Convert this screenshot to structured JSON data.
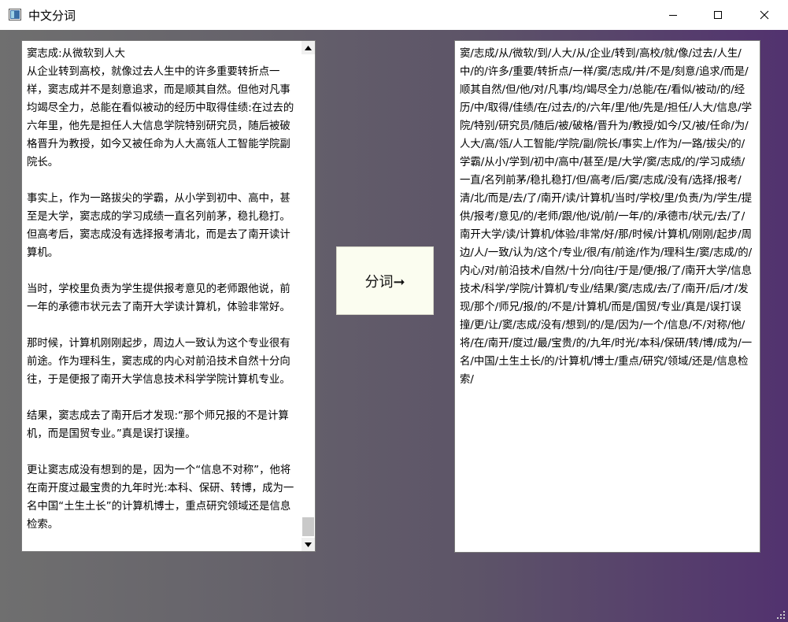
{
  "window": {
    "title": "中文分词",
    "controls": {
      "minimize_icon": "minimize-icon",
      "maximize_icon": "maximize-icon",
      "close_icon": "close-icon"
    },
    "colors": {
      "background_start": "#6f6f6f",
      "background_end": "#52326f",
      "button_bg": "#fbfdf0"
    }
  },
  "input": {
    "text": "窦志成:从微软到人大\n从企业转到高校，就像过去人生中的许多重要转折点一样，窦志成并不是刻意追求，而是顺其自然。但他对凡事均竭尽全力，总能在看似被动的经历中取得佳绩:在过去的六年里，他先是担任人大信息学院特别研究员，随后被破格晋升为教授，如今又被任命为人大高瓴人工智能学院副院长。\n\n事实上，作为一路拔尖的学霸，从小学到初中、高中，甚至是大学，窦志成的学习成绩一直名列前茅，稳扎稳打。但高考后，窦志成没有选择报考清北，而是去了南开读计算机。\n\n当时，学校里负责为学生提供报考意见的老师跟他说，前一年的承德市状元去了南开大学读计算机，体验非常好。\n\n那时候，计算机刚刚起步，周边人一致认为这个专业很有前途。作为理科生，窦志成的内心对前沿技术自然十分向往，于是便报了南开大学信息技术科学学院计算机专业。\n\n结果，窦志成去了南开后才发现:“那个师兄报的不是计算机，而是国贸专业。”真是误打误撞。\n\n更让窦志成没有想到的是，因为一个“信息不对称”，他将在南开度过最宝贵的九年时光:本科、保研、转博，成为一名中国“土生土长”的计算机博士，重点研究领域还是信息检索。"
  },
  "button": {
    "label": "分词➞"
  },
  "output": {
    "text": "窦/志成/从/微软/到/人大/从/企业/转到/高校/就/像/过去/人生/中/的/许多/重要/转折点/一样/窦/志成/并/不是/刻意/追求/而是/顺其自然/但/他/对/凡事/均/竭尽全力/总能/在/看似/被动/的/经历/中/取得/佳绩/在/过去/的/六年/里/他/先是/担任/人大/信息/学院/特别/研究员/随后/被/破格/晋升为/教授/如今/又/被/任命/为/人大/高/瓴/人工智能/学院/副/院长/事实上/作为/一路/拔尖/的/学霸/从小/学到/初中/高中/甚至/是/大学/窦/志成/的/学习成绩/一直/名列前茅/稳扎稳打/但/高考/后/窦/志成/没有/选择/报考/清/北/而是/去/了/南开/读/计算机/当时/学校/里/负责/为/学生/提供/报考/意见/的/老师/跟/他/说/前/一年/的/承德市/状元/去/了/南开大学/读/计算机/体验/非常/好/那/时候/计算机/刚刚/起步/周边/人/一致/认为/这个/专业/很/有/前途/作为/理科生/窦/志成/的/内心/对/前沿技术/自然/十分/向往/于是/便/报/了/南开大学/信息技术/科学/学院/计算机/专业/结果/窦/志成/去/了/南开/后/才/发现/那个/师兄/报/的/不是/计算机/而是/国贸/专业/真是/误打误撞/更/让/窦/志成/没有/想到/的/是/因为/一个/信息/不/对称/他/将/在/南开/度过/最/宝贵/的/九年/时光/本科/保研/转/博/成为/一名/中国/土生土长/的/计算机/博士/重点/研究/领域/还是/信息检索/"
  }
}
